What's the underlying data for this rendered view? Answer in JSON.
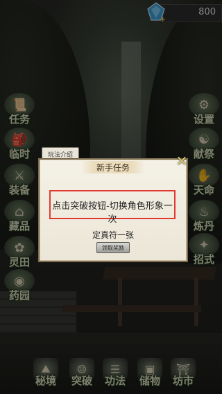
{
  "currency": {
    "amount": "800",
    "icon": "blue-gem-icon"
  },
  "left_menu": [
    {
      "label": "任务",
      "icon": "scroll-icon"
    },
    {
      "label": "临时",
      "icon": "bag-icon"
    },
    {
      "label": "装备",
      "icon": "armor-icon"
    },
    {
      "label": "藏品",
      "icon": "chest-icon"
    },
    {
      "label": "灵田",
      "icon": "field-icon"
    },
    {
      "label": "药园",
      "icon": "egg-icon"
    }
  ],
  "right_menu": [
    {
      "label": "设置",
      "icon": "gear-icon"
    },
    {
      "label": "献祭",
      "icon": "hands-icon"
    },
    {
      "label": "天命",
      "icon": "fate-icon"
    },
    {
      "label": "炼丹",
      "icon": "cauldron-icon"
    },
    {
      "label": "招式",
      "icon": "skill-icon"
    }
  ],
  "bottom_menu": [
    {
      "label": "秘境",
      "icon": "ruins-icon"
    },
    {
      "label": "突破",
      "icon": "character-icon"
    },
    {
      "label": "功法",
      "icon": "book-icon"
    },
    {
      "label": "储物",
      "icon": "storage-icon"
    },
    {
      "label": "坊市",
      "icon": "market-icon"
    }
  ],
  "intro_tab": "玩法介绍",
  "dialog": {
    "title": "新手任务",
    "task": "点击突破按钮-切换角色形象一次",
    "reward": "定真符一张",
    "claim_button": "领取奖励"
  },
  "colors": {
    "highlight_border": "#e23a33",
    "dialog_bg": "#f4f1e6"
  }
}
